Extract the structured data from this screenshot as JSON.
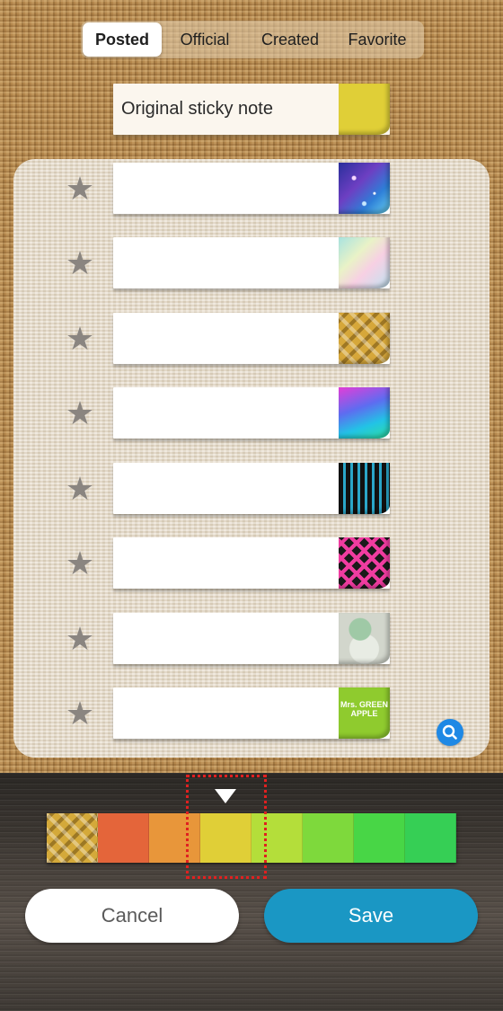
{
  "tabs": [
    {
      "label": "Posted",
      "active": true
    },
    {
      "label": "Official",
      "active": false
    },
    {
      "label": "Created",
      "active": false
    },
    {
      "label": "Favorite",
      "active": false
    }
  ],
  "original_note": {
    "label": "Original sticky note",
    "tab_color": "#e0cf37"
  },
  "notes": [
    {
      "pattern": "galaxy",
      "favorite": false
    },
    {
      "pattern": "watercolor",
      "favorite": false
    },
    {
      "pattern": "gold-plaid",
      "favorite": false
    },
    {
      "pattern": "pink-blue-gradient",
      "favorite": false
    },
    {
      "pattern": "black-blue-stripes",
      "favorite": false
    },
    {
      "pattern": "pink-black-plaid",
      "favorite": false
    },
    {
      "pattern": "green-cat-illustration",
      "favorite": false
    },
    {
      "pattern": "green-apple-logo",
      "favorite": false,
      "logo_text": "Mrs. GREEN APPLE"
    }
  ],
  "palette": [
    {
      "name": "gold-plaid",
      "color": "#d4a93a"
    },
    {
      "name": "orange-red",
      "color": "#e4653a"
    },
    {
      "name": "orange",
      "color": "#e8963a"
    },
    {
      "name": "yellow",
      "color": "#e0cf37"
    },
    {
      "name": "yellow-green",
      "color": "#b4de3a"
    },
    {
      "name": "light-green",
      "color": "#7ed93c"
    },
    {
      "name": "green",
      "color": "#48d646"
    },
    {
      "name": "emerald",
      "color": "#36cf55"
    }
  ],
  "selected_palette_index": 3,
  "buttons": {
    "cancel": "Cancel",
    "save": "Save"
  },
  "icons": {
    "star": "star-icon",
    "search": "search-icon",
    "indicator": "triangle-down-icon"
  }
}
